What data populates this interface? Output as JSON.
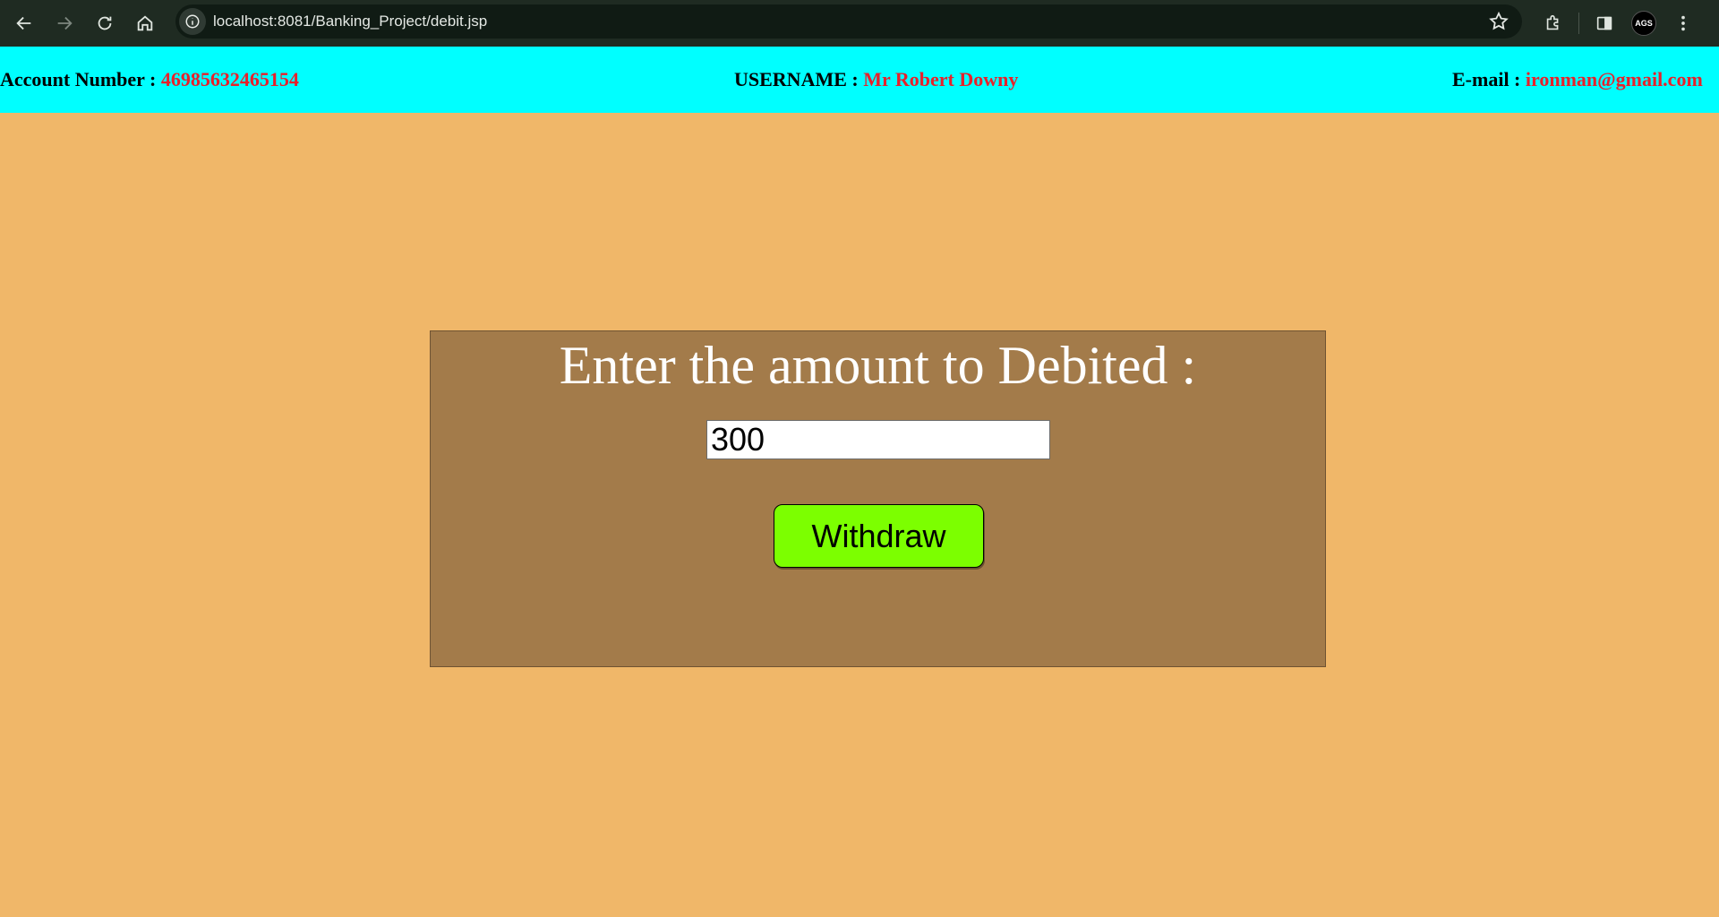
{
  "browser": {
    "url": "localhost:8081/Banking_Project/debit.jsp",
    "profile_initials": "AGS",
    "icons": [
      "back-icon",
      "forward-icon",
      "reload-icon",
      "home-icon",
      "site-info-icon",
      "bookmark-star-icon",
      "extensions-icon",
      "side-panel-icon",
      "profile-avatar",
      "menu-kebab-icon"
    ]
  },
  "header": {
    "account_label": "Account Number :",
    "account_number": "46985632465154",
    "username_label": "USERNAME :",
    "username": "Mr Robert Downy",
    "email_label": "E-mail :",
    "email": "ironman@gmail.com"
  },
  "form": {
    "title": "Enter the amount to Debited :",
    "amount_value": "300",
    "submit_label": "Withdraw"
  },
  "colors": {
    "page_background": "#f0b769",
    "header_background": "#00ffff",
    "header_value": "#e8202a",
    "card_background": "#a37b4a",
    "button_background": "#7cff00"
  }
}
